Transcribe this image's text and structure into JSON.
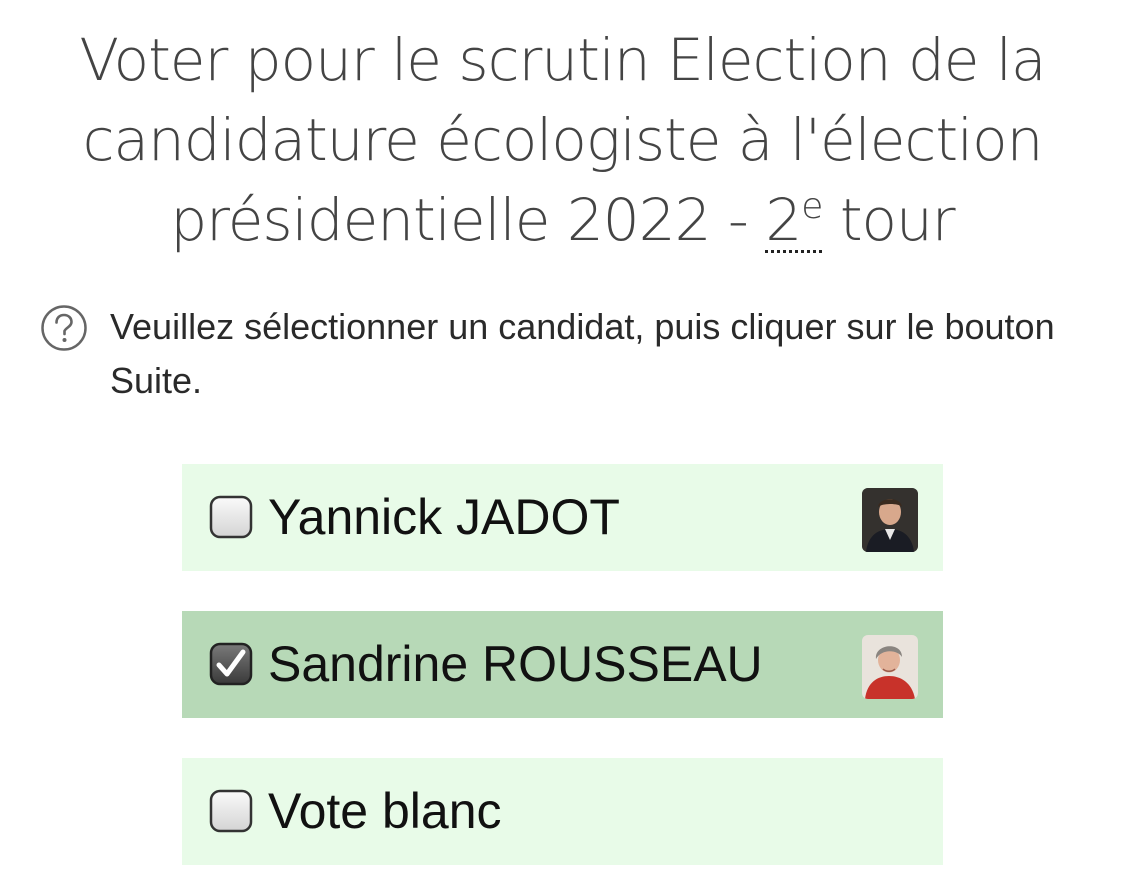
{
  "title": {
    "line1": "Voter pour le scrutin Election de la",
    "line2": "candidature écologiste à l'élection",
    "line3_prefix": "présidentielle 2022 -",
    "ordinal_number": "2",
    "ordinal_suffix": "e",
    "line3_suffix": "tour"
  },
  "instructions": {
    "icon": "question-circle-icon",
    "text": "Veuillez sélectionner un candidat, puis cliquer sur le bouton Suite."
  },
  "choices": [
    {
      "label": "Yannick JADOT",
      "checked": false,
      "photo": "candidate-photo"
    },
    {
      "label": "Sandrine ROUSSEAU",
      "checked": true,
      "photo": "candidate-photo"
    },
    {
      "label": "Vote blanc",
      "checked": false
    }
  ],
  "colors": {
    "choice_background": "#e8fbe8",
    "choice_selected_background": "#b7d9b7",
    "title_text": "#444444"
  }
}
